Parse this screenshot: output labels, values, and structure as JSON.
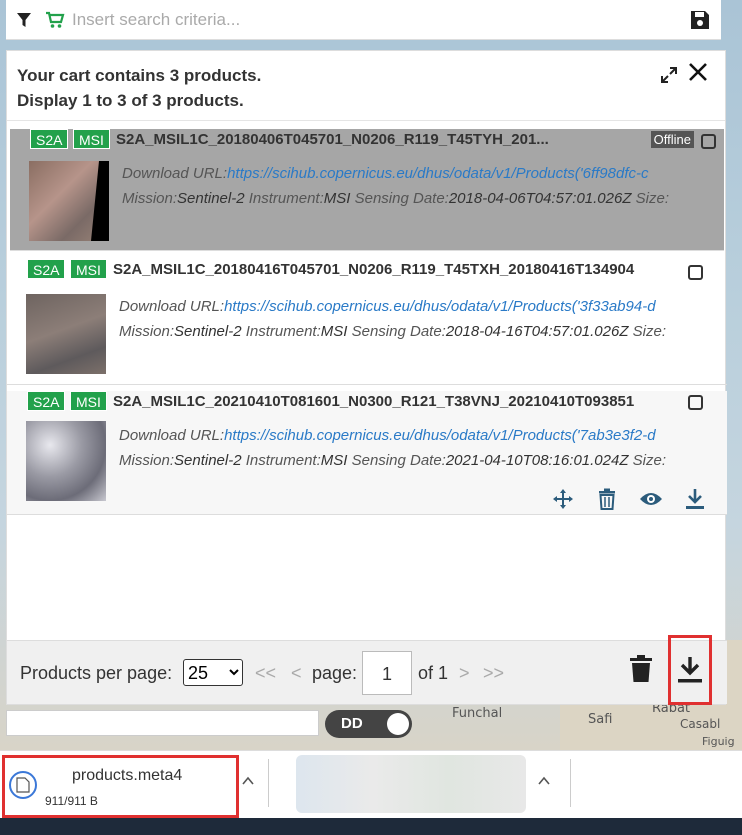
{
  "search": {
    "placeholder": "Insert search criteria..."
  },
  "cart": {
    "line1": "Your cart contains 3 products.",
    "line2": "Display 1 to 3 of 3 products."
  },
  "products": [
    {
      "badges": [
        "S2A",
        "MSI"
      ],
      "name": "S2A_MSIL1C_20180406T045701_N0206_R119_T45TYH_201...",
      "status": "Offline",
      "url_label": "Download URL:",
      "url": "https://scihub.copernicus.eu/dhus/odata/v1/Products('6ff98dfc-c",
      "mission_label": "Mission:",
      "mission": "Sentinel-2",
      "instrument_label": "Instrument:",
      "instrument": "MSI",
      "sensing_label": "Sensing Date:",
      "sensing": "2018-04-06T04:57:01.026Z",
      "size_label": "Size:"
    },
    {
      "badges": [
        "S2A",
        "MSI"
      ],
      "name": "S2A_MSIL1C_20180416T045701_N0206_R119_T45TXH_20180416T134904",
      "url_label": "Download URL:",
      "url": "https://scihub.copernicus.eu/dhus/odata/v1/Products('3f33ab94-d",
      "mission_label": "Mission:",
      "mission": "Sentinel-2",
      "instrument_label": "Instrument:",
      "instrument": "MSI",
      "sensing_label": "Sensing Date:",
      "sensing": "2018-04-16T04:57:01.026Z",
      "size_label": "Size:"
    },
    {
      "badges": [
        "S2A",
        "MSI"
      ],
      "name": "S2A_MSIL1C_20210410T081601_N0300_R121_T38VNJ_20210410T093851",
      "url_label": "Download URL:",
      "url": "https://scihub.copernicus.eu/dhus/odata/v1/Products('7ab3e3f2-d",
      "mission_label": "Mission:",
      "mission": "Sentinel-2",
      "instrument_label": "Instrument:",
      "instrument": "MSI",
      "sensing_label": "Sensing Date:",
      "sensing": "2021-04-10T08:16:01.024Z",
      "size_label": "Size:"
    }
  ],
  "footer": {
    "per_page_label": "Products per page:",
    "per_page_value": "25",
    "first": "<<",
    "prev": "<",
    "page_label": "page:",
    "page_value": "1",
    "of_label": "of 1",
    "next": ">",
    "last": ">>"
  },
  "toggle": {
    "label": "DD"
  },
  "map_labels": [
    "Funchal",
    "Rabat",
    "Safi",
    "Casabl",
    "Figuig"
  ],
  "download": {
    "filename": "products.meta4",
    "size": "911/911 B"
  },
  "colors": {
    "badge": "#22a14b",
    "highlight": "#e03030",
    "link": "#2a7ac7"
  }
}
